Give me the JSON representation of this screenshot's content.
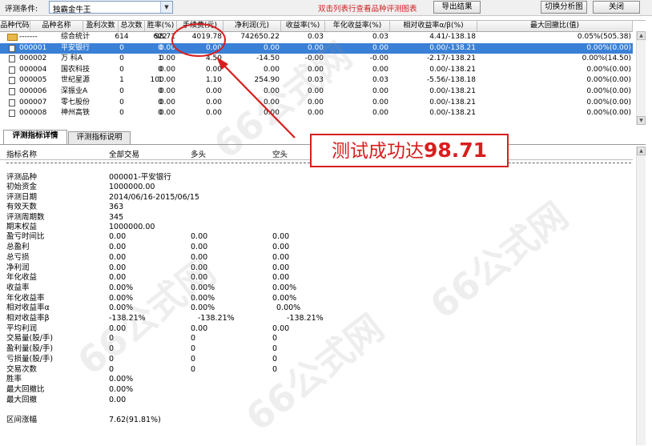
{
  "toolbar": {
    "condition_label": "评测条件:",
    "formula_value": "独霸金牛王",
    "hint": "双击列表行查看品种评测图表",
    "export_label": "导出结果",
    "switch_label": "切换分析图",
    "close_label": "关闭"
  },
  "grid": {
    "headers": [
      "品种代码",
      "品种名称",
      "盈利次数",
      "总次数",
      "胜率(%)",
      "手续费(元)",
      "净利润(元)",
      "收益率(%)",
      "年化收益率(%)",
      "相对收益率α/β(%)",
      "最大回撤比(值)"
    ],
    "rows": [
      {
        "icon": "folder-icon",
        "cells": [
          "-------",
          "综合统计",
          "614",
          "622",
          "98.71",
          "4019.78",
          "742650.22",
          "0.03",
          "0.03",
          "4.41/-138.18",
          "0.05%(505.38)"
        ]
      },
      {
        "icon": "doc-icon",
        "selected": true,
        "cells": [
          "000001",
          "平安银行",
          "0",
          "0",
          "0.00",
          "0.00",
          "0.00",
          "0.00",
          "0.00",
          "0.00/-138.21",
          "0.00%(0.00)"
        ]
      },
      {
        "icon": "doc-icon",
        "cells": [
          "000002",
          "万 科A",
          "0",
          "1",
          "0.00",
          "4.50",
          "-14.50",
          "-0.00",
          "-0.00",
          "-2.17/-138.21",
          "0.00%(14.50)"
        ]
      },
      {
        "icon": "doc-icon",
        "cells": [
          "000004",
          "国农科技",
          "0",
          "0",
          "0.00",
          "0.00",
          "0.00",
          "0.00",
          "0.00",
          "0.00/-138.21",
          "0.00%(0.00)"
        ]
      },
      {
        "icon": "doc-icon",
        "cells": [
          "000005",
          "世纪星源",
          "1",
          "1",
          "100.00",
          "1.10",
          "254.90",
          "0.03",
          "0.03",
          "-5.56/-138.18",
          "0.00%(0.00)"
        ]
      },
      {
        "icon": "doc-icon",
        "cells": [
          "000006",
          "深振业A",
          "0",
          "0",
          "0.00",
          "0.00",
          "0.00",
          "0.00",
          "0.00",
          "0.00/-138.21",
          "0.00%(0.00)"
        ]
      },
      {
        "icon": "doc-icon",
        "cells": [
          "000007",
          "零七股份",
          "0",
          "0",
          "0.00",
          "0.00",
          "0.00",
          "0.00",
          "0.00",
          "0.00/-138.21",
          "0.00%(0.00)"
        ]
      },
      {
        "icon": "doc-icon",
        "cells": [
          "000008",
          "神州高铁",
          "0",
          "0",
          "0.00",
          "0.00",
          "0.00",
          "0.00",
          "0.00",
          "0.00/-138.21",
          "0.00%(0.00)"
        ]
      }
    ]
  },
  "tabs": {
    "details": "评测指标详情",
    "explain": "评测指标说明"
  },
  "detail": {
    "headers": [
      "指标名称",
      "全部交易",
      "多头",
      "空头"
    ],
    "info": [
      [
        "评测品种",
        "000001-平安银行"
      ],
      [
        "初始资金",
        "1000000.00"
      ],
      [
        "评测日期",
        "2014/06/16-2015/06/15"
      ],
      [
        "有效天数",
        "363"
      ],
      [
        "评测周期数",
        "345"
      ],
      [
        "期末权益",
        "1000000.00"
      ]
    ],
    "metrics": [
      [
        "盈亏时间比",
        "0.00",
        "0.00",
        "0.00"
      ],
      [
        "总盈利",
        "0.00",
        "0.00",
        "0.00"
      ],
      [
        "总亏损",
        "0.00",
        "0.00",
        "0.00"
      ],
      [
        "净利润",
        "0.00",
        "0.00",
        "0.00"
      ],
      [
        "年化收益",
        "0.00",
        "0.00",
        "0.00"
      ],
      [
        "收益率",
        "0.00%",
        "0.00%",
        "0.00%"
      ],
      [
        "年化收益率",
        "0.00%",
        "0.00%",
        "0.00%"
      ],
      [
        "相对收益率α",
        "0.00%",
        "0.00%",
        "0.00%"
      ],
      [
        "相对收益率β",
        "-138.21%",
        "-138.21%",
        "-138.21%"
      ],
      [
        "平均利润",
        "0.00",
        "0.00",
        "0.00"
      ],
      [
        "交易量(股/手)",
        "0",
        "0",
        "0"
      ],
      [
        "盈利量(股/手)",
        "0",
        "0",
        "0"
      ],
      [
        "亏损量(股/手)",
        "0",
        "0",
        "0"
      ],
      [
        "交易次数",
        "0",
        "0",
        "0"
      ],
      [
        "胜率",
        "0.00%",
        "",
        ""
      ],
      [
        "最大回撤比",
        "0.00%",
        "",
        ""
      ],
      [
        "最大回撤",
        "0.00",
        "",
        ""
      ],
      [
        "",
        "",
        " ",
        ""
      ],
      [
        "区间涨幅",
        "7.62(91.81%)",
        "",
        ""
      ]
    ]
  },
  "banner": {
    "text": "测试成功达",
    "value": "98.71"
  },
  "watermark": {
    "text": "66公式网"
  },
  "colors": {
    "accent_red": "#d81e1e",
    "selection_blue": "#3a80d6"
  }
}
